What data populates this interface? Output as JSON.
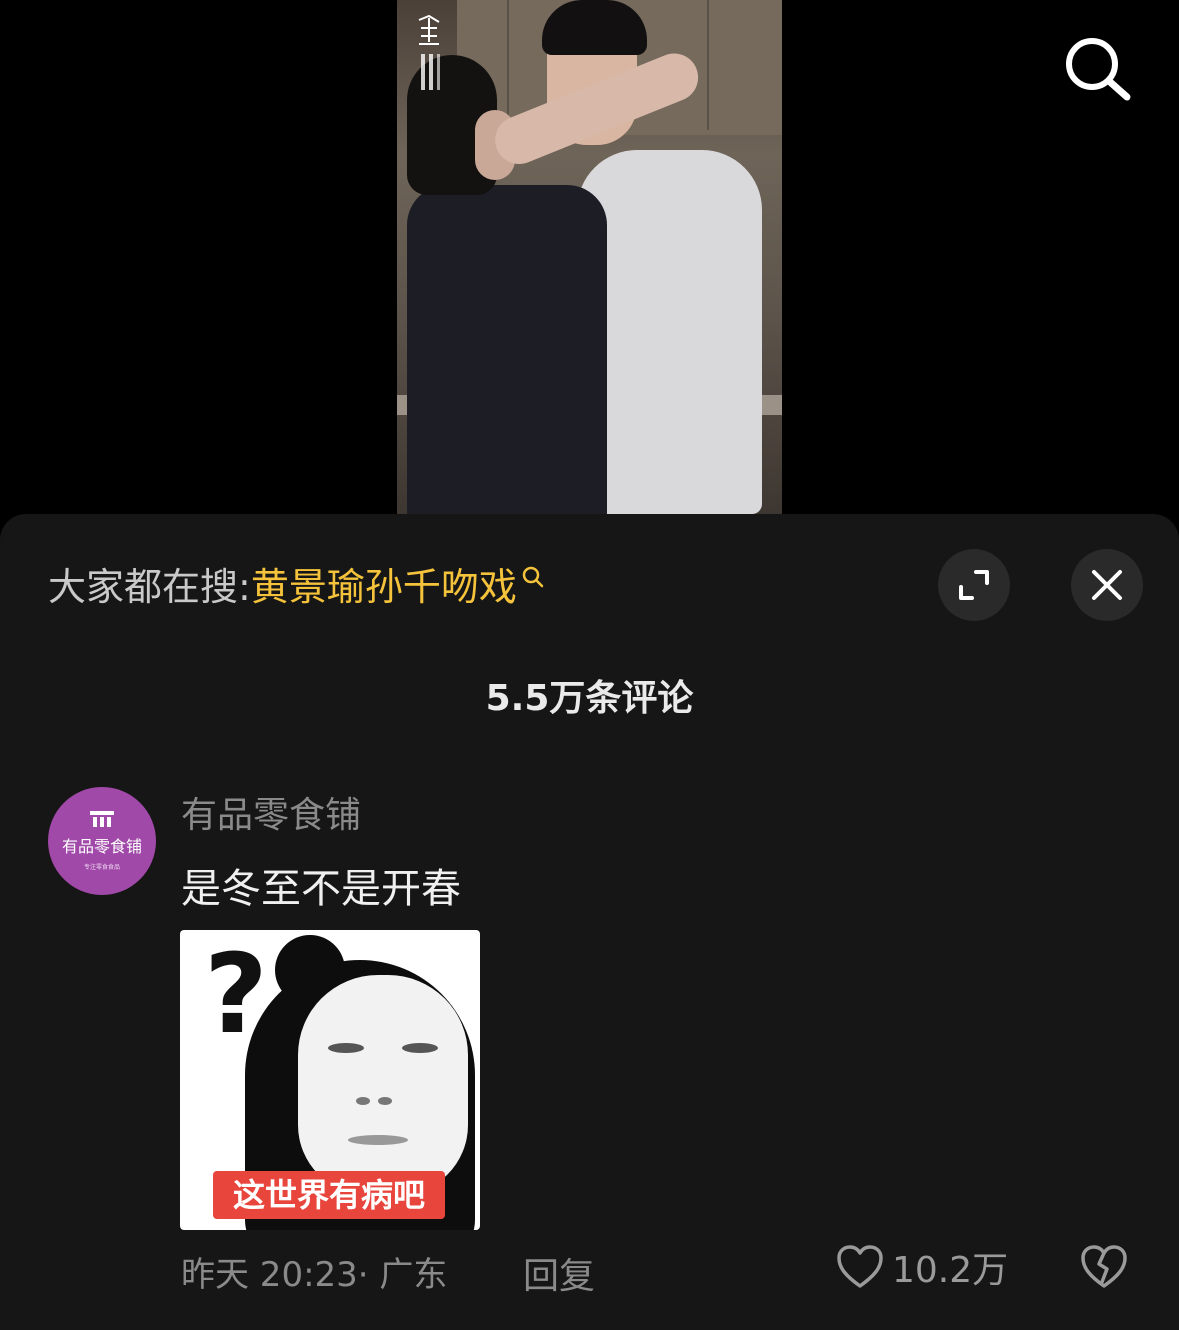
{
  "hot_search": {
    "prefix": "大家都在搜:",
    "term": "黄景瑜孙千吻戏"
  },
  "comments_header": {
    "count_label": "5.5万条评论"
  },
  "comment": {
    "username": "有品零食铺",
    "avatar_name": "有品零食铺",
    "avatar_sub": "专注零食食品",
    "text": "是冬至不是开春",
    "meme_caption": "这世界有病吧",
    "time_location": "昨天 20:23· 广东",
    "reply_label": "回复",
    "like_count": "10.2万"
  },
  "icons": {
    "search": "search-icon",
    "expand": "expand-icon",
    "close": "close-icon",
    "like": "heart-icon",
    "dislike": "broken-heart-icon"
  },
  "colors": {
    "hot_term": "#f5c33b",
    "panel_bg": "#161616",
    "avatar_bg": "#a049a8",
    "meme_caption_bg": "#e8453c"
  }
}
